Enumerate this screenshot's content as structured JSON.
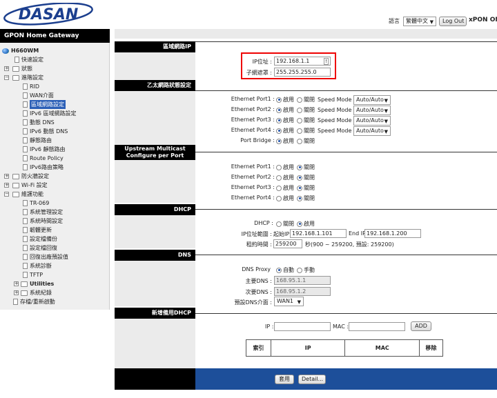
{
  "header": {
    "logo": "DASAN",
    "language_label": "語言",
    "language_value": "繁體中文",
    "logout": "Log Out",
    "product": "xPON ONU"
  },
  "nav": {
    "title": "GPON Home Gateway",
    "root": "H660WM",
    "items": [
      "快速設定",
      "狀態",
      "進階設定",
      "RID",
      "WAN介面",
      "區域網路設定",
      "IPv6 區域網路設定",
      "動態 DNS",
      "IPv6 動態 DNS",
      "靜態路由",
      "IPv6 靜態路由",
      "Route Policy",
      "IPv6路由策略",
      "防火牆設定",
      "Wi-Fi 設定",
      "維護功能",
      "TR-069",
      "系統管理設定",
      "系統時間設定",
      "韌體更新",
      "設定檔備份",
      "設定檔回復",
      "回復出廠預設值",
      "系統診斷",
      "TFTP",
      "Utilities",
      "系統紀錄",
      "存檔/重新啟動"
    ]
  },
  "lan": {
    "section": "區域網路IP",
    "ip_label": "IP位址 :",
    "ip_value": "192.168.1.1",
    "mask_label": "子網遮罩 :",
    "mask_value": "255.255.255.0"
  },
  "ethernet": {
    "section": "乙太網路狀態設定",
    "enable": "啟用",
    "disable": "關閉",
    "speed_label": "Speed Mode",
    "speed_value": "Auto/Auto",
    "ports": [
      "Ethernet Port1 :",
      "Ethernet Port2 :",
      "Ethernet Port3 :",
      "Ethernet Port4 :"
    ],
    "bridge_label": "Port Bridge :"
  },
  "multicast": {
    "section_l1": "Upstream Multicast",
    "section_l2": "Configure per Port",
    "ports": [
      "Ethernet Port1 :",
      "Ethernet Port2 :",
      "Ethernet Port3 :",
      "Ethernet Port4 :"
    ],
    "enable": "啟用",
    "disable": "關閉"
  },
  "dhcp": {
    "section": "DHCP",
    "label": "DHCP :",
    "off": "關閉",
    "on": "啟用",
    "range_label": "IP位址範圍 :",
    "start_label": "起始IP",
    "start_value": "192.168.1.101",
    "end_label": "End IP",
    "end_value": "192.168.1.200",
    "lease_label": "租約時間 :",
    "lease_value": "259200",
    "lease_hint": "秒(900 ~ 259200, 預設: 259200)"
  },
  "dns": {
    "section": "DNS",
    "proxy_label": "DNS Proxy",
    "auto": "自動",
    "manual": "手動",
    "primary_label": "主要DNS :",
    "primary_value": "168.95.1.1",
    "secondary_label": "次要DNS :",
    "secondary_value": "168.95.1.2",
    "default_label": "預設DNS介面 :",
    "default_value": "WAN1"
  },
  "static_dhcp": {
    "section": "新增備用DHCP",
    "ip_label": "IP :",
    "mac_label": "MAC :",
    "add": "ADD",
    "columns": [
      "索引",
      "IP",
      "MAC",
      "移除"
    ]
  },
  "footer": {
    "apply": "套用",
    "detail": "Detail..."
  }
}
